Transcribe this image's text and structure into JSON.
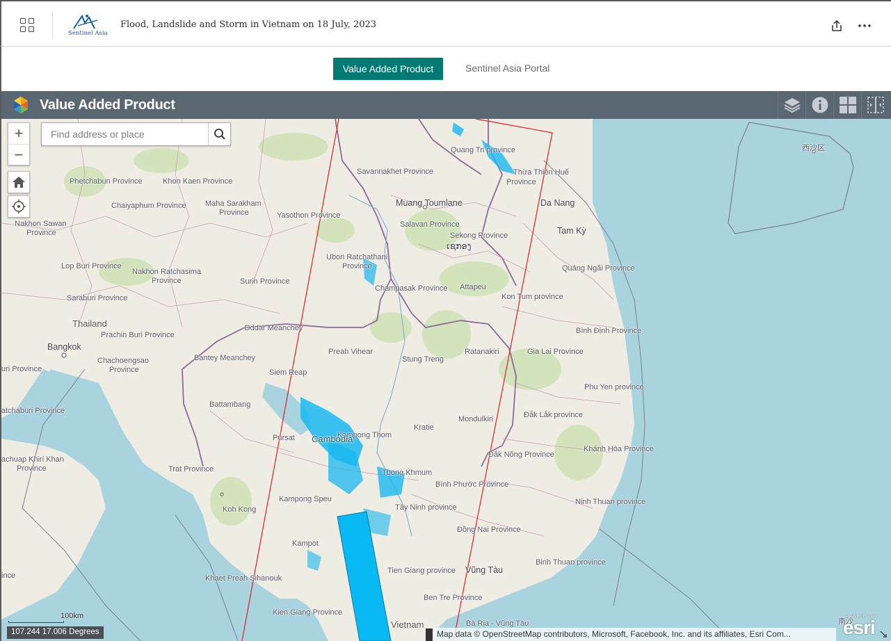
{
  "header": {
    "app_title": "Flood, Landslide and Storm in Vietnam on 18 July, 2023",
    "logo_text": "Sentinel Asia"
  },
  "tabs": [
    {
      "label": "Value Added Product",
      "active": true
    },
    {
      "label": "Sentinel Asia Portal",
      "active": false
    }
  ],
  "map_header": {
    "title": "Value Added Product"
  },
  "search": {
    "placeholder": "Find address or place"
  },
  "map_labels": {
    "thailand": "Thailand",
    "bangkok": "Bangkok",
    "cambodia": "Cambodia",
    "muang_toumlane": "Muang Toumlane",
    "da_nang": "Da Nang",
    "tam_ky": "Tam Kỳ",
    "vung_tau": "Vũng Tàu",
    "xisha": "西沙区",
    "lao_script": "ເຊກອງ",
    "nan_sha": "南沙",
    "quang_tri": "Quang Tri province",
    "thua_thien_hue": "Thừa Thiên Huế",
    "province": "Province",
    "savannakhet": "Savannakhet Province",
    "phetchabun": "Phetchabun Province",
    "khon_kaen": "Khon Kaen Province",
    "chaiyaphum": "Chaiyaphum Province",
    "maha_sarakham": "Maha Sarakham",
    "maha_province": "Province",
    "yasothon": "Yasothon Province",
    "nakhon_sawan": "Nakhon Sawan",
    "nakhon_sawan_province": "Province",
    "salavan": "Salavan Province",
    "sekong": "Sekong Province",
    "lop_buri": "Lop Buri Province",
    "nakhon_ratchasima": "Nakhon Ratchasima",
    "nakhon_ratchasima_province": "Province",
    "ubon": "Ubon Ratchathani",
    "ubon_province": "Province",
    "surin": "Surin Province",
    "quang_ngai": "Quảng Ngãi Province",
    "saraburi": "Saraburi Province",
    "champasak": "Champasak Province",
    "attapeu": "Attapeu",
    "kon_tum": "Kon Tum province",
    "oddar": "Oddar Meanchey",
    "prachin_buri": "Prachin Buri Province",
    "binh_dinh": "Bình Định Province",
    "banteay": "Bantey Meanchey",
    "preah_vihear": "Preah Vihear",
    "stung_treng": "Stung Treng",
    "ratanakiri": "Ratanakiri",
    "gia_lai": "Gia Lai Province",
    "chachoengsao": "Chachoengsao",
    "chachoengsao_province": "Province",
    "uri_province": "uri Province",
    "siem_reap": "Siem Reap",
    "phu_yen": "Phu Yen province",
    "battambang": "Battambang",
    "kampong_thom": "Kampong Thom",
    "atchaburi": "atchaburi Province",
    "dak_lak": "Đắk Lắk province",
    "kratie": "Kratie",
    "mondulkiri": "Mondulkiri",
    "pursat": "Pursat",
    "khanh_hoa": "Khánh Hòa Province",
    "dak_nong": "Đắk Nông Province",
    "prachuap": "achuap Khiri Khan",
    "prachuap_province": "Province",
    "trat": "Trat Province",
    "tbong_khmum": "Tbong Khmum",
    "binh_phuoc": "Bình Phước Province",
    "kampong_speu": "Kampong Speu",
    "ninh_thuan": "Ninh Thuan province",
    "tay_ninh": "Tây Ninh province",
    "koh_kong": "Koh Kong",
    "dong_nai": "Đồng Nai Province",
    "kampot": "Kampot",
    "binh_thuan": "Binh Thuan province",
    "tien_giang": "Tien Giang province",
    "ince": "ince",
    "khaet": "Khaet Preah Sihanouk",
    "ben_tre": "Ben Tre Province",
    "kien_giang": "Kien Giang Province",
    "vietnam": "Vietnam",
    "ba_ria": "Bà Rịa - Vũng Tàu"
  },
  "scale": {
    "label": "100km"
  },
  "coordinates": {
    "text": "107.244 17.006 Degrees"
  },
  "attribution": {
    "text": "Map data © OpenStreetMap contributors, Microsoft, Facebook, Inc. and its affiliates, Esri Com..."
  },
  "esri_logo": {
    "powered_by": "POWERED BY",
    "wordmark": "esri"
  },
  "colors": {
    "accent": "#007a72",
    "map_header": "#5b6673",
    "water": "#a9d3de",
    "land": "#efece4",
    "flood": "#1ab8f0",
    "footprint": "#e11f1f",
    "swath": "#08b9f3"
  },
  "icons": {
    "apps": "apps-grid-icon",
    "share": "share-icon",
    "more": "more-icon",
    "layers": "layers-icon",
    "info": "info-icon",
    "basemap": "basemap-gallery-icon",
    "swipe": "swipe-icon",
    "home": "home-icon",
    "locate": "locate-icon",
    "search": "search-icon"
  }
}
